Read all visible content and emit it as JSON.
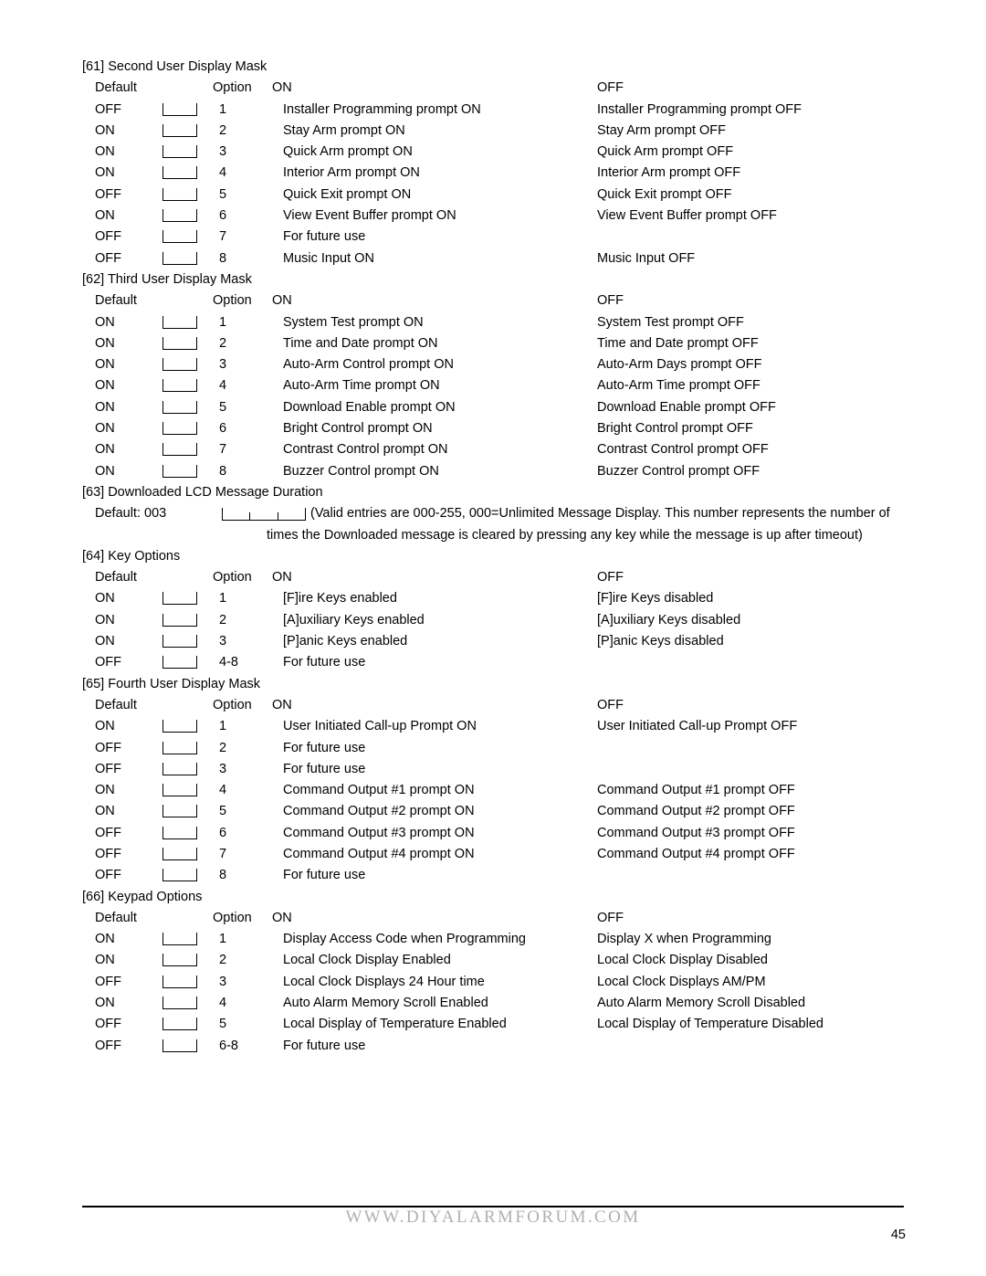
{
  "page": {
    "number": "45",
    "footer_url": "WWW.DIYALARMFORUM.COM"
  },
  "headers": {
    "default": "Default",
    "option": "Option",
    "on": "ON",
    "off": "OFF"
  },
  "sections": [
    {
      "title": "[61] Second User Display Mask",
      "rows": [
        {
          "default": "OFF",
          "num": "1",
          "on": "Installer Programming prompt ON",
          "off": "Installer Programming prompt OFF"
        },
        {
          "default": "ON",
          "num": "2",
          "on": "Stay Arm prompt ON",
          "off": "Stay Arm prompt OFF"
        },
        {
          "default": "ON",
          "num": "3",
          "on": "Quick Arm prompt ON",
          "off": "Quick Arm prompt OFF"
        },
        {
          "default": "ON",
          "num": "4",
          "on": "Interior Arm prompt ON",
          "off": "Interior Arm prompt OFF"
        },
        {
          "default": "OFF",
          "num": "5",
          "on": "Quick Exit prompt ON",
          "off": "Quick Exit prompt OFF"
        },
        {
          "default": "ON",
          "num": "6",
          "on": "View Event Buffer prompt ON",
          "off": "View Event Buffer prompt OFF"
        },
        {
          "default": "OFF",
          "num": "7",
          "on": "For future use",
          "off": ""
        },
        {
          "default": "OFF",
          "num": "8",
          "on": "Music Input ON",
          "off": "Music Input OFF"
        }
      ]
    },
    {
      "title": "[62] Third User Display Mask",
      "rows": [
        {
          "default": "ON",
          "num": "1",
          "on": "System Test prompt ON",
          "off": "System Test prompt OFF"
        },
        {
          "default": "ON",
          "num": "2",
          "on": "Time and Date prompt ON",
          "off": "Time and Date prompt OFF"
        },
        {
          "default": "ON",
          "num": "3",
          "on": "Auto-Arm Control prompt ON",
          "off": "Auto-Arm Days prompt OFF"
        },
        {
          "default": "ON",
          "num": "4",
          "on": "Auto-Arm Time prompt ON",
          "off": "Auto-Arm Time prompt OFF"
        },
        {
          "default": "ON",
          "num": "5",
          "on": "Download Enable prompt ON",
          "off": "Download Enable prompt OFF"
        },
        {
          "default": "ON",
          "num": "6",
          "on": "Bright Control prompt ON",
          "off": "Bright Control prompt OFF"
        },
        {
          "default": "ON",
          "num": "7",
          "on": "Contrast Control prompt ON",
          "off": "Contrast Control prompt OFF"
        },
        {
          "default": "ON",
          "num": "8",
          "on": "Buzzer Control prompt ON",
          "off": "Buzzer Control prompt OFF"
        }
      ]
    },
    {
      "title": "[64] Key Options",
      "rows": [
        {
          "default": "ON",
          "num": "1",
          "on": "[F]ire Keys enabled",
          "off": "[F]ire Keys disabled"
        },
        {
          "default": "ON",
          "num": "2",
          "on": "[A]uxiliary Keys enabled",
          "off": "[A]uxiliary Keys disabled"
        },
        {
          "default": "ON",
          "num": "3",
          "on": "[P]anic Keys enabled",
          "off": "[P]anic Keys disabled"
        },
        {
          "default": "OFF",
          "num": "4-8",
          "on": "For future use",
          "off": ""
        }
      ]
    },
    {
      "title": "[65] Fourth User Display Mask",
      "rows": [
        {
          "default": "ON",
          "num": "1",
          "on": "User Initiated Call-up Prompt ON",
          "off": "User Initiated Call-up Prompt OFF"
        },
        {
          "default": "OFF",
          "num": "2",
          "on": "For future use",
          "off": ""
        },
        {
          "default": "OFF",
          "num": "3",
          "on": "For future use",
          "off": ""
        },
        {
          "default": "ON",
          "num": "4",
          "on": "Command Output #1 prompt ON",
          "off": "Command Output #1 prompt OFF"
        },
        {
          "default": "ON",
          "num": "5",
          "on": "Command Output #2 prompt ON",
          "off": "Command Output #2 prompt OFF"
        },
        {
          "default": "OFF",
          "num": "6",
          "on": "Command Output #3 prompt ON",
          "off": "Command Output #3 prompt OFF"
        },
        {
          "default": "OFF",
          "num": "7",
          "on": "Command Output #4 prompt ON",
          "off": "Command Output #4 prompt OFF"
        },
        {
          "default": "OFF",
          "num": "8",
          "on": "For future use",
          "off": ""
        }
      ]
    },
    {
      "title": "[66] Keypad Options",
      "rows": [
        {
          "default": "ON",
          "num": "1",
          "on": "Display Access Code when Programming",
          "off": "Display  X  when Programming"
        },
        {
          "default": "ON",
          "num": "2",
          "on": "Local Clock Display Enabled",
          "off": "Local Clock Display Disabled"
        },
        {
          "default": "OFF",
          "num": "3",
          "on": "Local Clock Displays 24 Hour time",
          "off": "Local Clock Displays AM/PM"
        },
        {
          "default": "ON",
          "num": "4",
          "on": "Auto Alarm Memory Scroll Enabled",
          "off": "Auto Alarm Memory Scroll Disabled"
        },
        {
          "default": "OFF",
          "num": "5",
          "on": "Local Display of Temperature Enabled",
          "off": "Local Display of Temperature Disabled"
        },
        {
          "default": "OFF",
          "num": "6-8",
          "on": "For future use",
          "off": ""
        }
      ]
    }
  ],
  "duration_section": {
    "title": "[63] Downloaded LCD Message Duration",
    "default_label": "Default: 003",
    "note_line1": "(Valid entries are 000-255,  000=Unlimited Message Display. This number represents the number of",
    "note_line2": "times the Downloaded message is cleared by pressing any key while the message is up after timeout)"
  }
}
